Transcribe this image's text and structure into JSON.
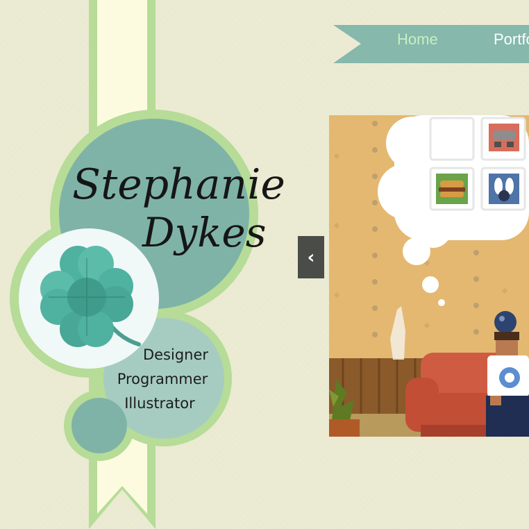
{
  "site": {
    "name_first": "Stephanie",
    "name_last": "Dykes",
    "roles": [
      "Designer",
      "Programmer",
      "Illustrator"
    ],
    "logo_icon": "four-leaf-clover-icon"
  },
  "nav": {
    "items": [
      {
        "label": "Home",
        "active": true
      },
      {
        "label": "Portfo",
        "active": false
      }
    ]
  },
  "slider": {
    "prev_icon": "‹",
    "thought_icons": [
      "blank-tile-icon",
      "game-console-icon",
      "burger-icon",
      "bowling-icon"
    ]
  },
  "colors": {
    "background": "#ecebd2",
    "teal": "#7fb3a8",
    "light_green": "#b6dc97",
    "ribbon": "#fdfbdf",
    "nav_active": "#c8f0c0",
    "nav_text": "#ffffff",
    "slider_button": "#4a4c48"
  }
}
